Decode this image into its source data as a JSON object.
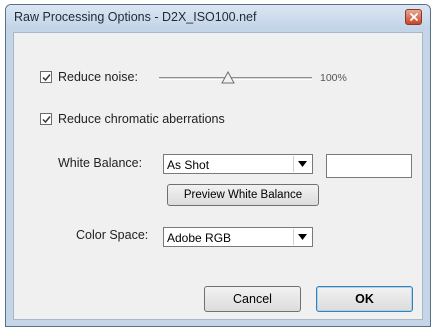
{
  "window": {
    "title": "Raw Processing Options - D2X_ISO100.nef",
    "close_icon": "close-icon",
    "accent": "#c4d5e8",
    "close_color": "#c7452a"
  },
  "options": {
    "reduce_noise": {
      "label": "Reduce noise:",
      "checked": true,
      "level_percent": 45,
      "value_text": "100%"
    },
    "chromatic": {
      "label": "Reduce chromatic aberrations",
      "checked": true
    }
  },
  "white_balance": {
    "label": "White Balance:",
    "selected": "As Shot",
    "custom_value": "",
    "preview_button": "Preview White Balance"
  },
  "color_space": {
    "label": "Color Space:",
    "selected": "Adobe RGB"
  },
  "buttons": {
    "cancel": "Cancel",
    "ok": "OK"
  }
}
